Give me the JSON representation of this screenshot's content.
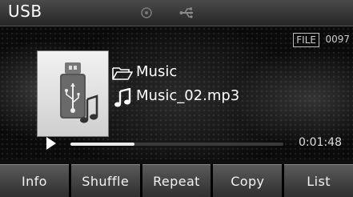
{
  "header": {
    "title": "USB",
    "disc_icon": "disc-icon",
    "usb_icon": "usb-symbol-icon"
  },
  "media": {
    "file_label": "FILE",
    "file_number": "0097",
    "folder_icon": "folder-icon",
    "folder_name": "Music",
    "track_icon": "music-note-icon",
    "track_name": "Music_02.mp3",
    "album_art_icon": "usb-music-icon",
    "elapsed": "0:01:48",
    "progress_fraction": 0.3
  },
  "buttons": [
    {
      "label": "Info"
    },
    {
      "label": "Shuffle"
    },
    {
      "label": "Repeat"
    },
    {
      "label": "Copy"
    },
    {
      "label": "List"
    }
  ],
  "colors": {
    "background": "#0e0e0e",
    "text": "#ffffff",
    "button_top": "#5a5a5a",
    "button_bottom": "#2e2e2e"
  }
}
